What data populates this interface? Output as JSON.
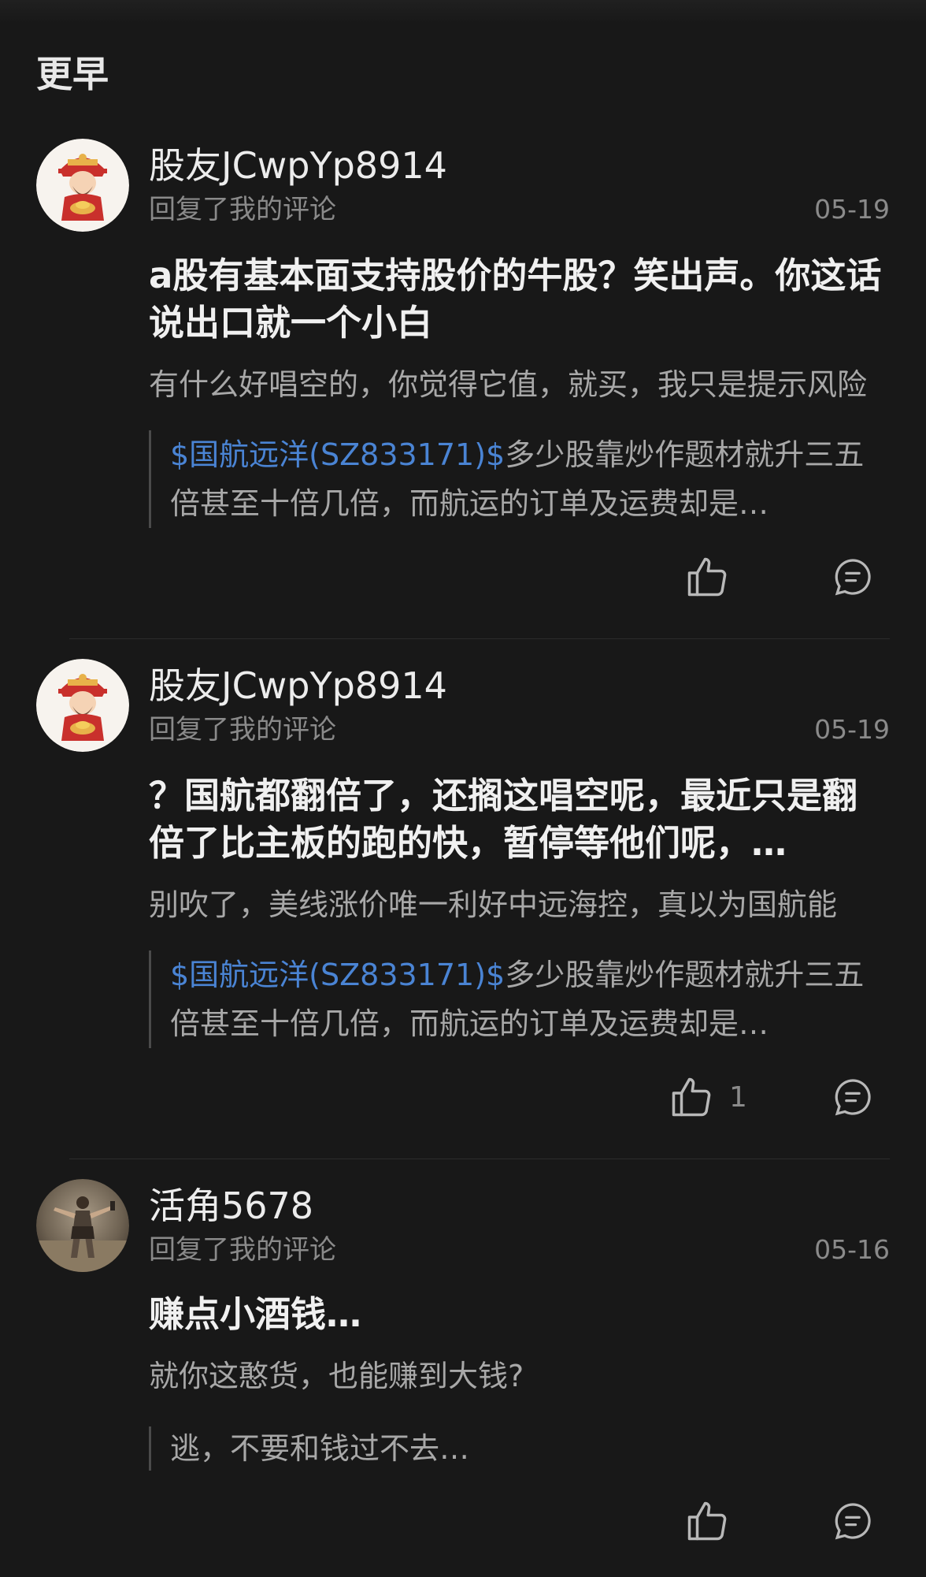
{
  "section_title": "更早",
  "notifications": [
    {
      "username": "股友JCwpYp8914",
      "action": "回复了我的评论",
      "date": "05-19",
      "reply": "a股有基本面支持股价的牛股？笑出声。你这话说出口就一个小白",
      "my_comment": "有什么好唱空的，你觉得它值，就买，我只是提示风险",
      "quote_link": "$国航远洋(SZ833171)$",
      "quote_text": "多少股靠炒作题材就升三五倍甚至十倍几倍，而航运的订单及运费却是…",
      "like_count": "",
      "avatar_icon": "god-of-wealth-avatar-icon"
    },
    {
      "username": "股友JCwpYp8914",
      "action": "回复了我的评论",
      "date": "05-19",
      "reply": "？国航都翻倍了，还搁这唱空呢，最近只是翻倍了比主板的跑的快，暂停等他们呢，…",
      "my_comment": "别吹了，美线涨价唯一利好中远海控，真以为国航能",
      "quote_link": "$国航远洋(SZ833171)$",
      "quote_text": "多少股靠炒作题材就升三五倍甚至十倍几倍，而航运的订单及运费却是…",
      "like_count": "1",
      "avatar_icon": "god-of-wealth-avatar-icon"
    },
    {
      "username": "活角5678",
      "action": "回复了我的评论",
      "date": "05-16",
      "reply": "赚点小酒钱…",
      "my_comment": "就你这憨货，也能赚到大钱?",
      "quote_link": "",
      "quote_text": "逃，不要和钱过不去…",
      "like_count": "",
      "avatar_icon": "gladiator-avatar-icon"
    }
  ],
  "colors": {
    "background": "#181818",
    "link": "#4a84d4",
    "secondary_text": "#8a8a8a"
  }
}
